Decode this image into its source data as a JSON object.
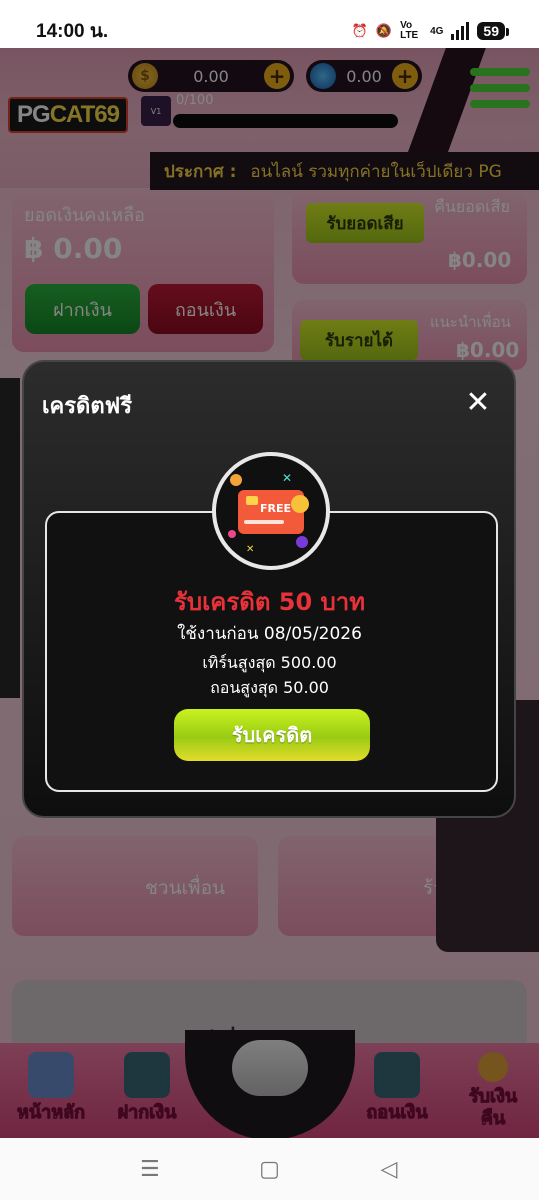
{
  "status_bar": {
    "time": "14:00 น.",
    "network": "4G",
    "volte": "Vo LTE",
    "battery": "59"
  },
  "header": {
    "logo_text_pg": "PG",
    "logo_text_rest": "CAT69",
    "coin_balance": "0.00",
    "gem_balance": "0.00",
    "level_progress": "0/100",
    "level_badge": "V1",
    "announce_label": "ประกาศ :",
    "announce_text": "อนไลน์ รวมทุกค่ายในเว็ปเดียว PG"
  },
  "wallet": {
    "balance_label": "ยอดเงินคงเหลือ",
    "balance_value": "฿ 0.00",
    "deposit_label": "ฝากเงิน",
    "withdraw_label": "ถอนเงิน"
  },
  "cashback": {
    "claim_loss_label": "รับยอดเสีย",
    "refund_label": "คืนยอดเสีย",
    "refund_value": "฿0.00",
    "claim_income_label": "รับรายได้",
    "referral_label": "แนะนำเพื่อน",
    "referral_value": "฿0.00"
  },
  "promo_cards": {
    "invite_label": "ชวนเพื่อน",
    "shop_label": "ร้านค้า"
  },
  "steps_label": "ส  ปการถอน",
  "bottom_nav": {
    "items": [
      {
        "label": "หน้าหลัก",
        "icon": "home-icon"
      },
      {
        "label": "ฝากเงิน",
        "icon": "atm-deposit-icon"
      },
      {
        "label": "",
        "icon": "gamepad-icon"
      },
      {
        "label": "ถอนเงิน",
        "icon": "atm-withdraw-icon"
      },
      {
        "label": "รับเงินคืน",
        "icon": "cashback-icon"
      }
    ]
  },
  "modal": {
    "title": "เครดิตฟรี",
    "close_icon": "close-icon",
    "badge_text": "FREE",
    "credit_title": "รับเครดิต 50 บาท",
    "expire_text": "ใช้งานก่อน 08/05/2026",
    "turnover_text": "เทิร์นสูงสุด 500.00",
    "max_withdraw_text": "ถอนสูงสุด 50.00",
    "claim_button": "รับเครดิต"
  },
  "colors": {
    "accent_green": "#9acb14",
    "title_red": "#e8323a",
    "pink": "#f07ca5"
  }
}
